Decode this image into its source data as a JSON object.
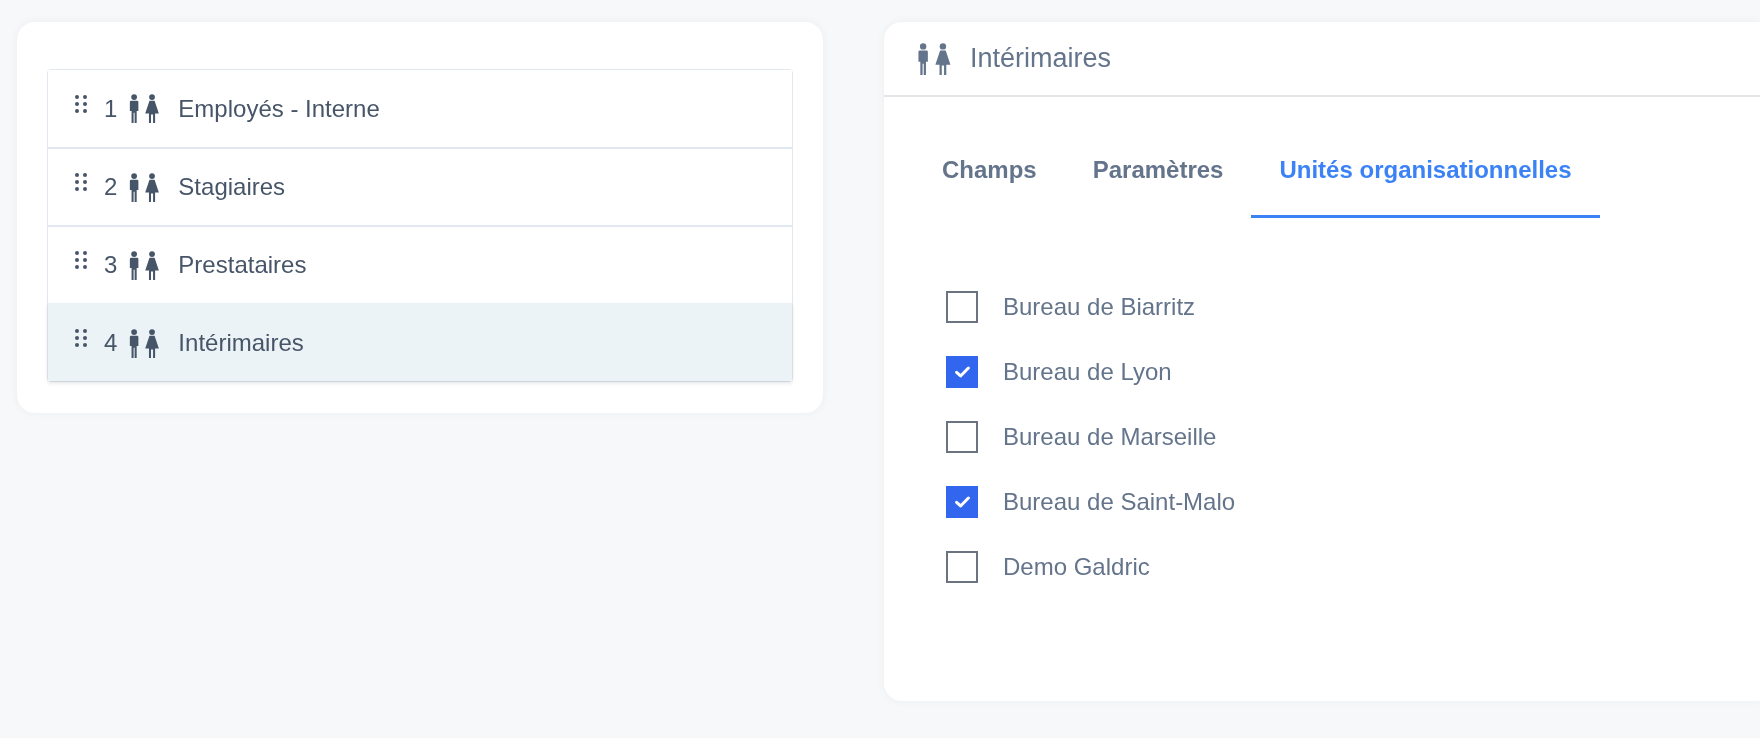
{
  "people_list": {
    "items": [
      {
        "number": "1",
        "label": "Employés - Interne",
        "selected": false
      },
      {
        "number": "2",
        "label": "Stagiaires",
        "selected": false
      },
      {
        "number": "3",
        "label": "Prestataires",
        "selected": false
      },
      {
        "number": "4",
        "label": "Intérimaires",
        "selected": true
      }
    ]
  },
  "detail_panel": {
    "title": "Intérimaires",
    "tabs": [
      {
        "label": "Champs",
        "selected": false
      },
      {
        "label": "Paramètres",
        "selected": false
      },
      {
        "label": "Unités organisationnelles",
        "selected": true
      }
    ],
    "org_units": [
      {
        "label": "Bureau de Biarritz",
        "checked": false
      },
      {
        "label": "Bureau de Lyon",
        "checked": true
      },
      {
        "label": "Bureau de Marseille",
        "checked": false
      },
      {
        "label": "Bureau de Saint-Malo",
        "checked": true
      },
      {
        "label": "Demo Galdric",
        "checked": false
      }
    ]
  }
}
